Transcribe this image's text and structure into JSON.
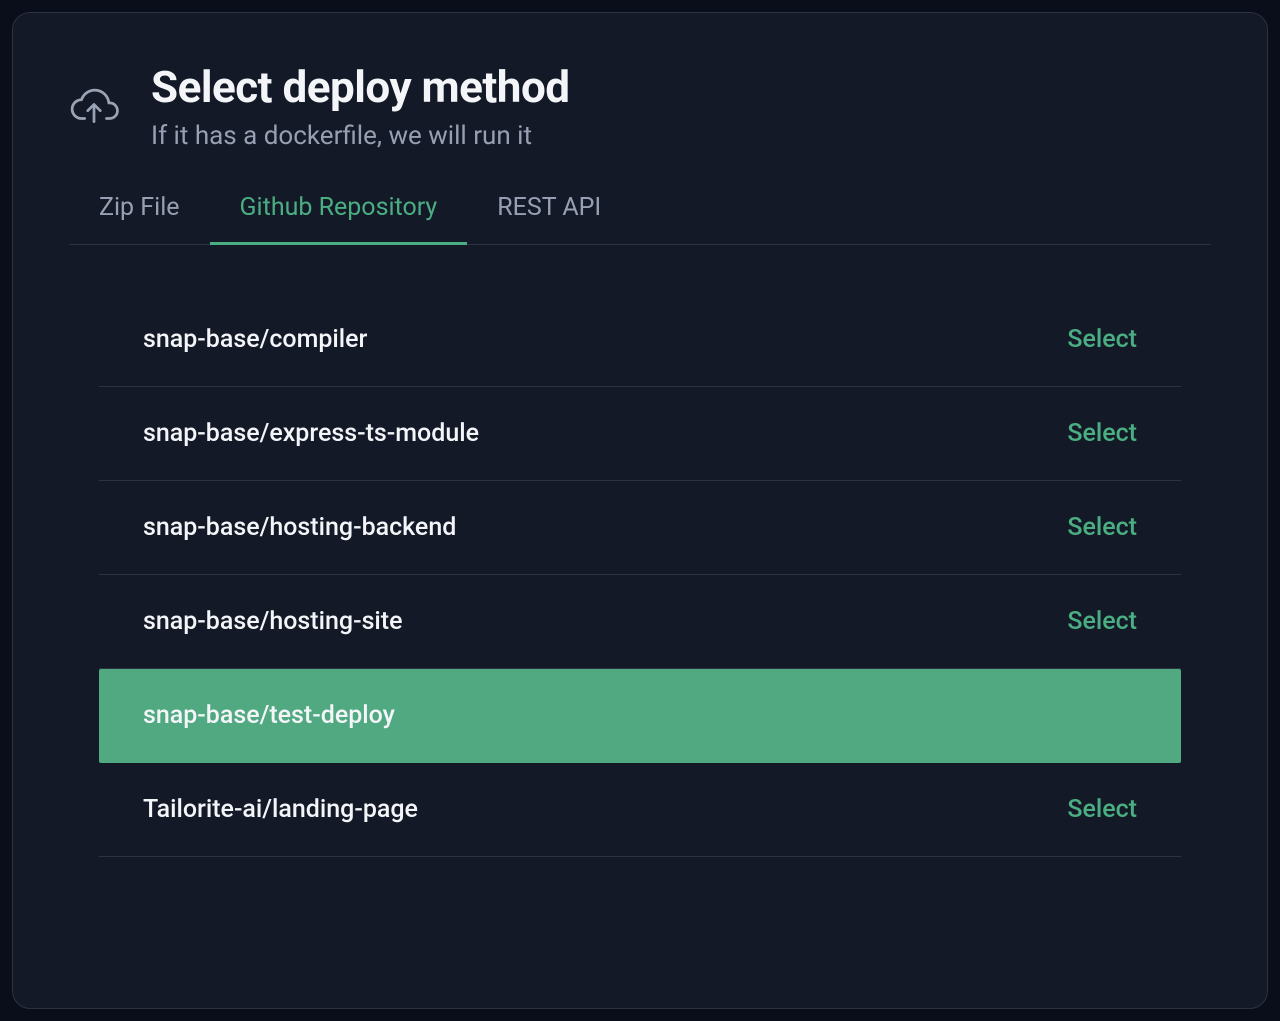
{
  "header": {
    "title": "Select deploy method",
    "subtitle": "If it has a dockerfile, we will run it"
  },
  "tabs": [
    {
      "label": "Zip File",
      "active": false
    },
    {
      "label": "Github Repository",
      "active": true
    },
    {
      "label": "REST API",
      "active": false
    }
  ],
  "select_label": "Select",
  "repos": [
    {
      "name": "snap-base/compiler",
      "selected": false
    },
    {
      "name": "snap-base/express-ts-module",
      "selected": false
    },
    {
      "name": "snap-base/hosting-backend",
      "selected": false
    },
    {
      "name": "snap-base/hosting-site",
      "selected": false
    },
    {
      "name": "snap-base/test-deploy",
      "selected": true
    },
    {
      "name": "Tailorite-ai/landing-page",
      "selected": false
    }
  ],
  "colors": {
    "accent": "#4aae82",
    "selected_bg": "#50a980",
    "card_bg": "#131926",
    "page_bg": "#0a0e1a",
    "text_primary": "#f3f5f9",
    "text_secondary": "#97a0b3",
    "border": "#2a3244"
  }
}
